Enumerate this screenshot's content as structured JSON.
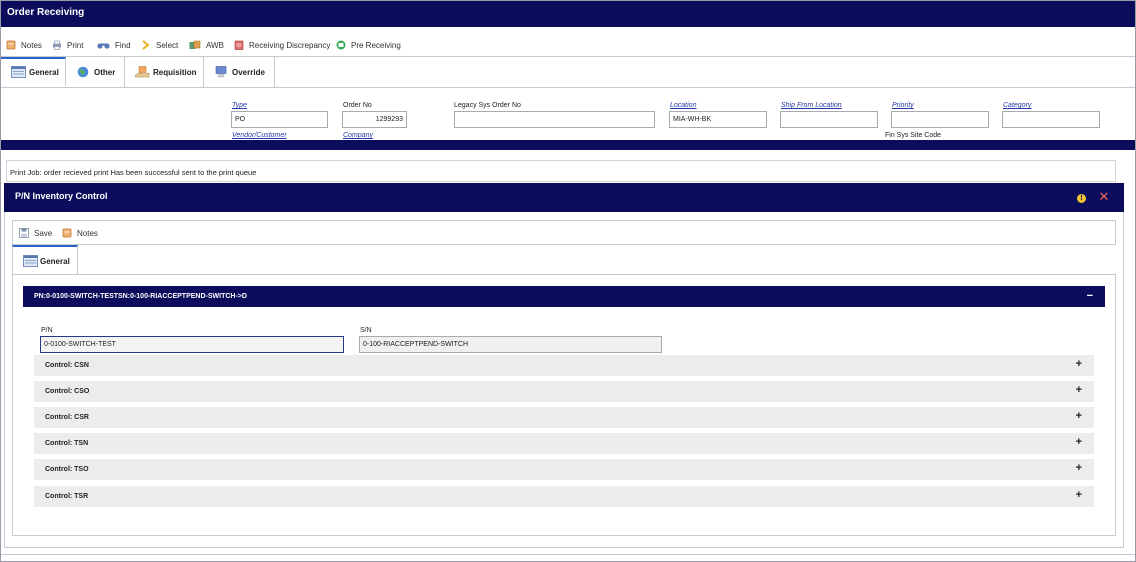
{
  "window": {
    "title": "Order Receiving"
  },
  "toolbar": {
    "items": [
      {
        "label": "Notes",
        "icon": "notes-icon"
      },
      {
        "label": "Print",
        "icon": "printer-icon"
      },
      {
        "label": "Find",
        "icon": "binoculars-icon"
      },
      {
        "label": "Select",
        "icon": "select-chevron-icon"
      },
      {
        "label": "AWB",
        "icon": "awb-icon"
      },
      {
        "label": "Receiving Discrepancy",
        "icon": "discrepancy-icon"
      },
      {
        "label": "Pre Receiving",
        "icon": "pre-receiving-icon"
      }
    ]
  },
  "tabs": [
    {
      "label": "General",
      "active": true
    },
    {
      "label": "Other"
    },
    {
      "label": "Requisition"
    },
    {
      "label": "Override"
    }
  ],
  "form": {
    "type": {
      "label": "Type",
      "value": "PO"
    },
    "order_no": {
      "label": "Order No",
      "value": "1299293"
    },
    "legacy": {
      "label": "Legacy Sys Order No",
      "value": ""
    },
    "location": {
      "label": "Location",
      "value": "MIA-WH-BK"
    },
    "ship_from": {
      "label": "Ship From Location",
      "value": ""
    },
    "priority": {
      "label": "Priority",
      "value": ""
    },
    "category": {
      "label": "Category",
      "value": ""
    },
    "vendor_customer": {
      "label": "Vendor/Customer"
    },
    "company": {
      "label": "Company"
    },
    "fin_sys_site_code": {
      "label": "Fin Sys Site Code"
    }
  },
  "print_message": "Print Job: order recieved print Has been successful sent to the print queue",
  "modal": {
    "title": "P/N Inventory Control",
    "toolbar": {
      "save": "Save",
      "notes": "Notes"
    },
    "tab": "General",
    "section_title": "PN:0-0100-SWITCH-TESTSN:0-100-RIACCEPTPEND-SWITCH->D",
    "pn": {
      "label": "P/N",
      "value": "0-0100-SWITCH-TEST"
    },
    "sn": {
      "label": "S/N",
      "value": "0-100-RIACCEPTPEND-SWITCH"
    },
    "controls": [
      "Control: CSN",
      "Control: CSO",
      "Control: CSR",
      "Control: TSN",
      "Control: TSO",
      "Control: TSR"
    ]
  },
  "colors": {
    "header_navy": "#0c0c5c",
    "link_blue": "#2838a8",
    "close_red": "#f06a52",
    "info_yellow": "#f2c230"
  }
}
